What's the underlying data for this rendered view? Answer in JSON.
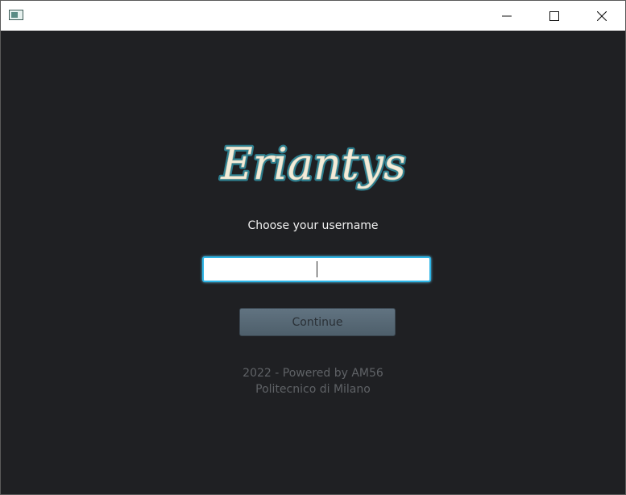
{
  "window": {
    "title": "",
    "controls": {
      "minimize_icon": "minimize-icon",
      "maximize_icon": "maximize-icon",
      "close_icon": "close-icon"
    }
  },
  "logo": {
    "text": "Eriantys"
  },
  "login": {
    "prompt": "Choose your username",
    "username_value": "",
    "username_placeholder": "",
    "continue_label": "Continue"
  },
  "footer": {
    "line1": "2022 - Powered by AM56",
    "line2": "Politecnico di Milano"
  },
  "colors": {
    "background": "#1f2023",
    "input_focus_border": "#2db5e6",
    "button_fill": "#56687a",
    "footer_text": "#5f6266",
    "logo_fill": "#f3ecd9",
    "logo_outline": "#2e7f8f"
  }
}
